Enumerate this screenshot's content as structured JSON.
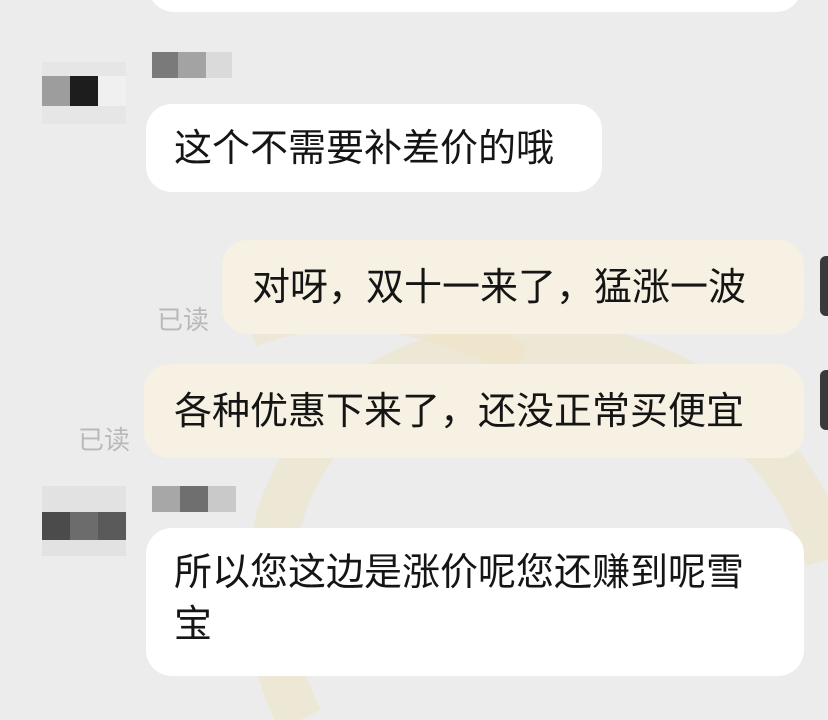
{
  "messages": [
    {
      "id": "m1",
      "direction": "incoming",
      "text": "这个不需要补差价的哦"
    },
    {
      "id": "m2",
      "direction": "outgoing",
      "text": "对呀，双十一来了，猛涨一波",
      "read_label": "已读"
    },
    {
      "id": "m3",
      "direction": "outgoing",
      "text": "各种优惠下来了，还没正常买便宜",
      "read_label": "已读"
    },
    {
      "id": "m4",
      "direction": "incoming",
      "text_line1": "所以您这边是涨价呢您还赚到呢雪",
      "text_line2": "宝"
    }
  ],
  "colors": {
    "background": "#ececec",
    "incoming_bubble": "#ffffff",
    "outgoing_bubble": "#f7f1e3",
    "read_label": "#b9b9b9",
    "watermark": "#efe3c2"
  }
}
